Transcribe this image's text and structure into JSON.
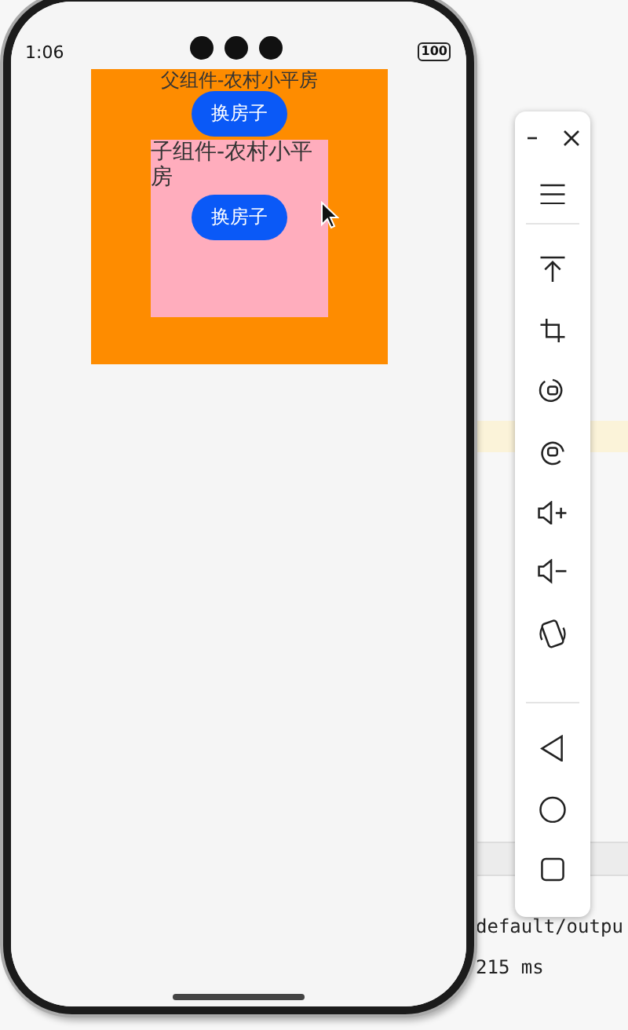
{
  "phone": {
    "status_bar": {
      "time": "1:06",
      "battery": "100"
    },
    "parent": {
      "title": "父组件-农村小平房",
      "button": "换房子"
    },
    "child": {
      "title": "子组件-农村小平房",
      "button": "换房子"
    }
  },
  "background_text": [
    "default/outpu",
    "215 ms"
  ]
}
